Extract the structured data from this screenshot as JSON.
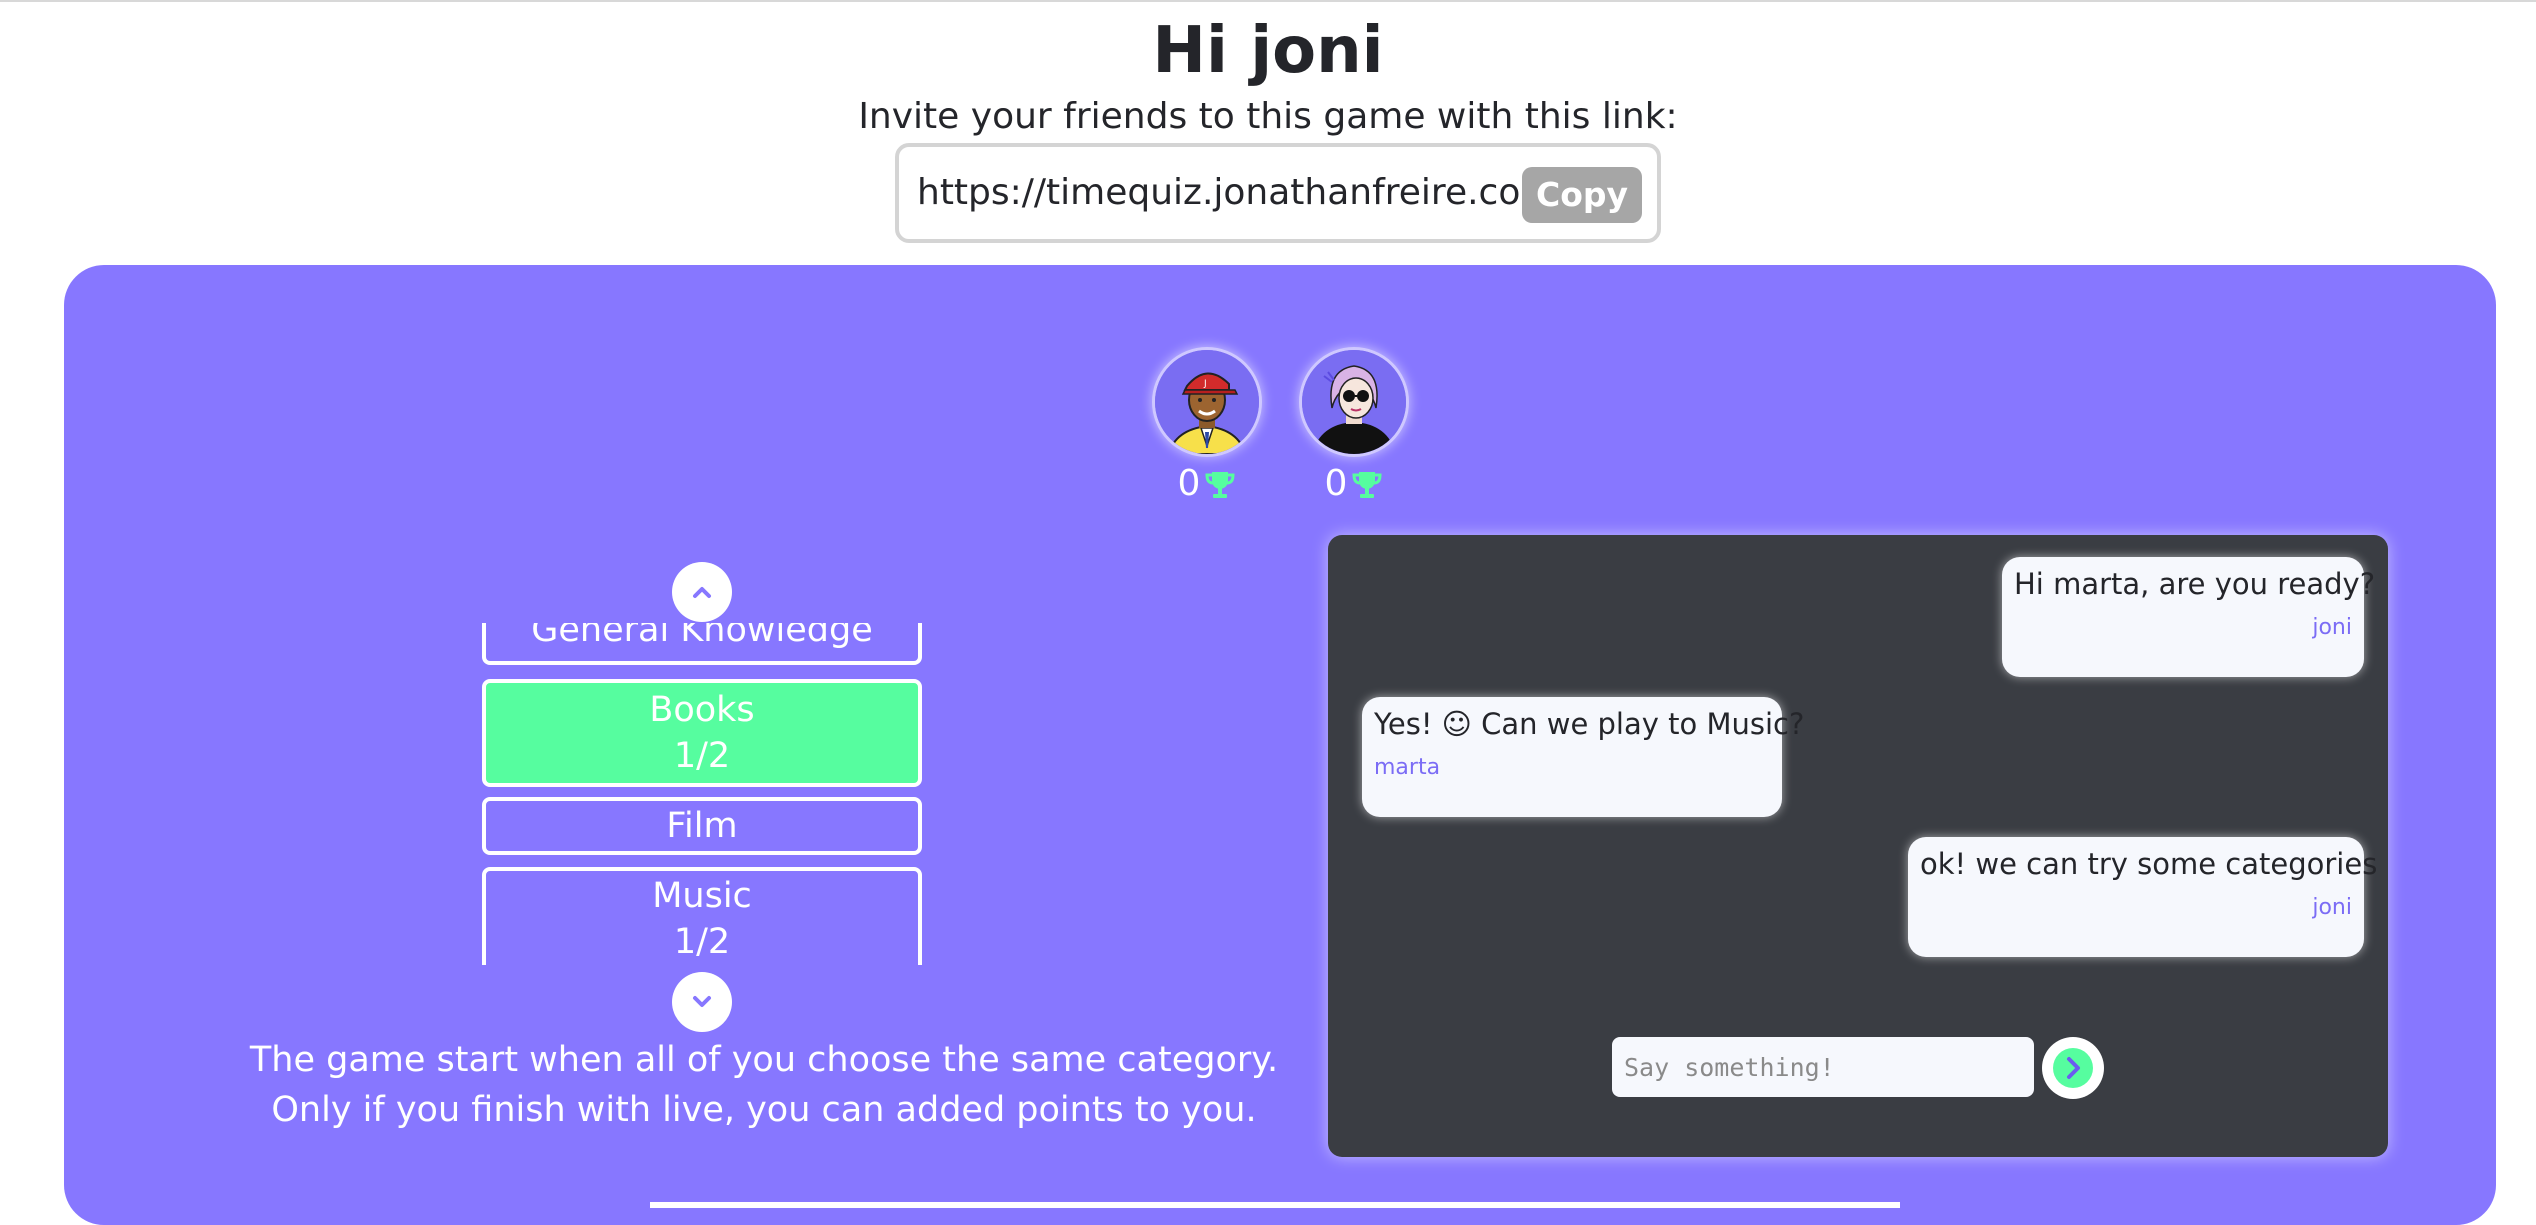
{
  "header": {
    "greeting": "Hi joni",
    "invite_text": "Invite your friends to this game with this link:",
    "link": "https://timequiz.jonathanfreire.com",
    "copy_label": "Copy"
  },
  "players": [
    {
      "score": "0",
      "avatar": "player-avatar-red-cap",
      "trophy_icon": "trophy-icon"
    },
    {
      "score": "0",
      "avatar": "player-avatar-pink-hair",
      "trophy_icon": "trophy-icon"
    }
  ],
  "categories": [
    {
      "name": "General Knowledge",
      "count": ""
    },
    {
      "name": "Books",
      "count": "1/2",
      "selected": true
    },
    {
      "name": "Film",
      "count": ""
    },
    {
      "name": "Music",
      "count": "1/2"
    }
  ],
  "rules": {
    "line1": "The game start when all of you choose the same category.",
    "line2": "Only if you finish with live, you can added points to you."
  },
  "chat": {
    "messages": [
      {
        "text": "Hi marta, are you ready?",
        "author": "joni",
        "side": "right"
      },
      {
        "text": "Yes! ☺ Can we play to Music?",
        "author": "marta",
        "side": "left"
      },
      {
        "text": "ok! we can try some categories",
        "author": "joni",
        "side": "right"
      }
    ],
    "input_placeholder": "Say something!",
    "send_icon": "chevron-right-icon"
  },
  "colors": {
    "panel": "#8777ff",
    "selected_category": "#56fd9f",
    "chat_bg": "#3a3d43",
    "trophy": "#56fd9f"
  }
}
